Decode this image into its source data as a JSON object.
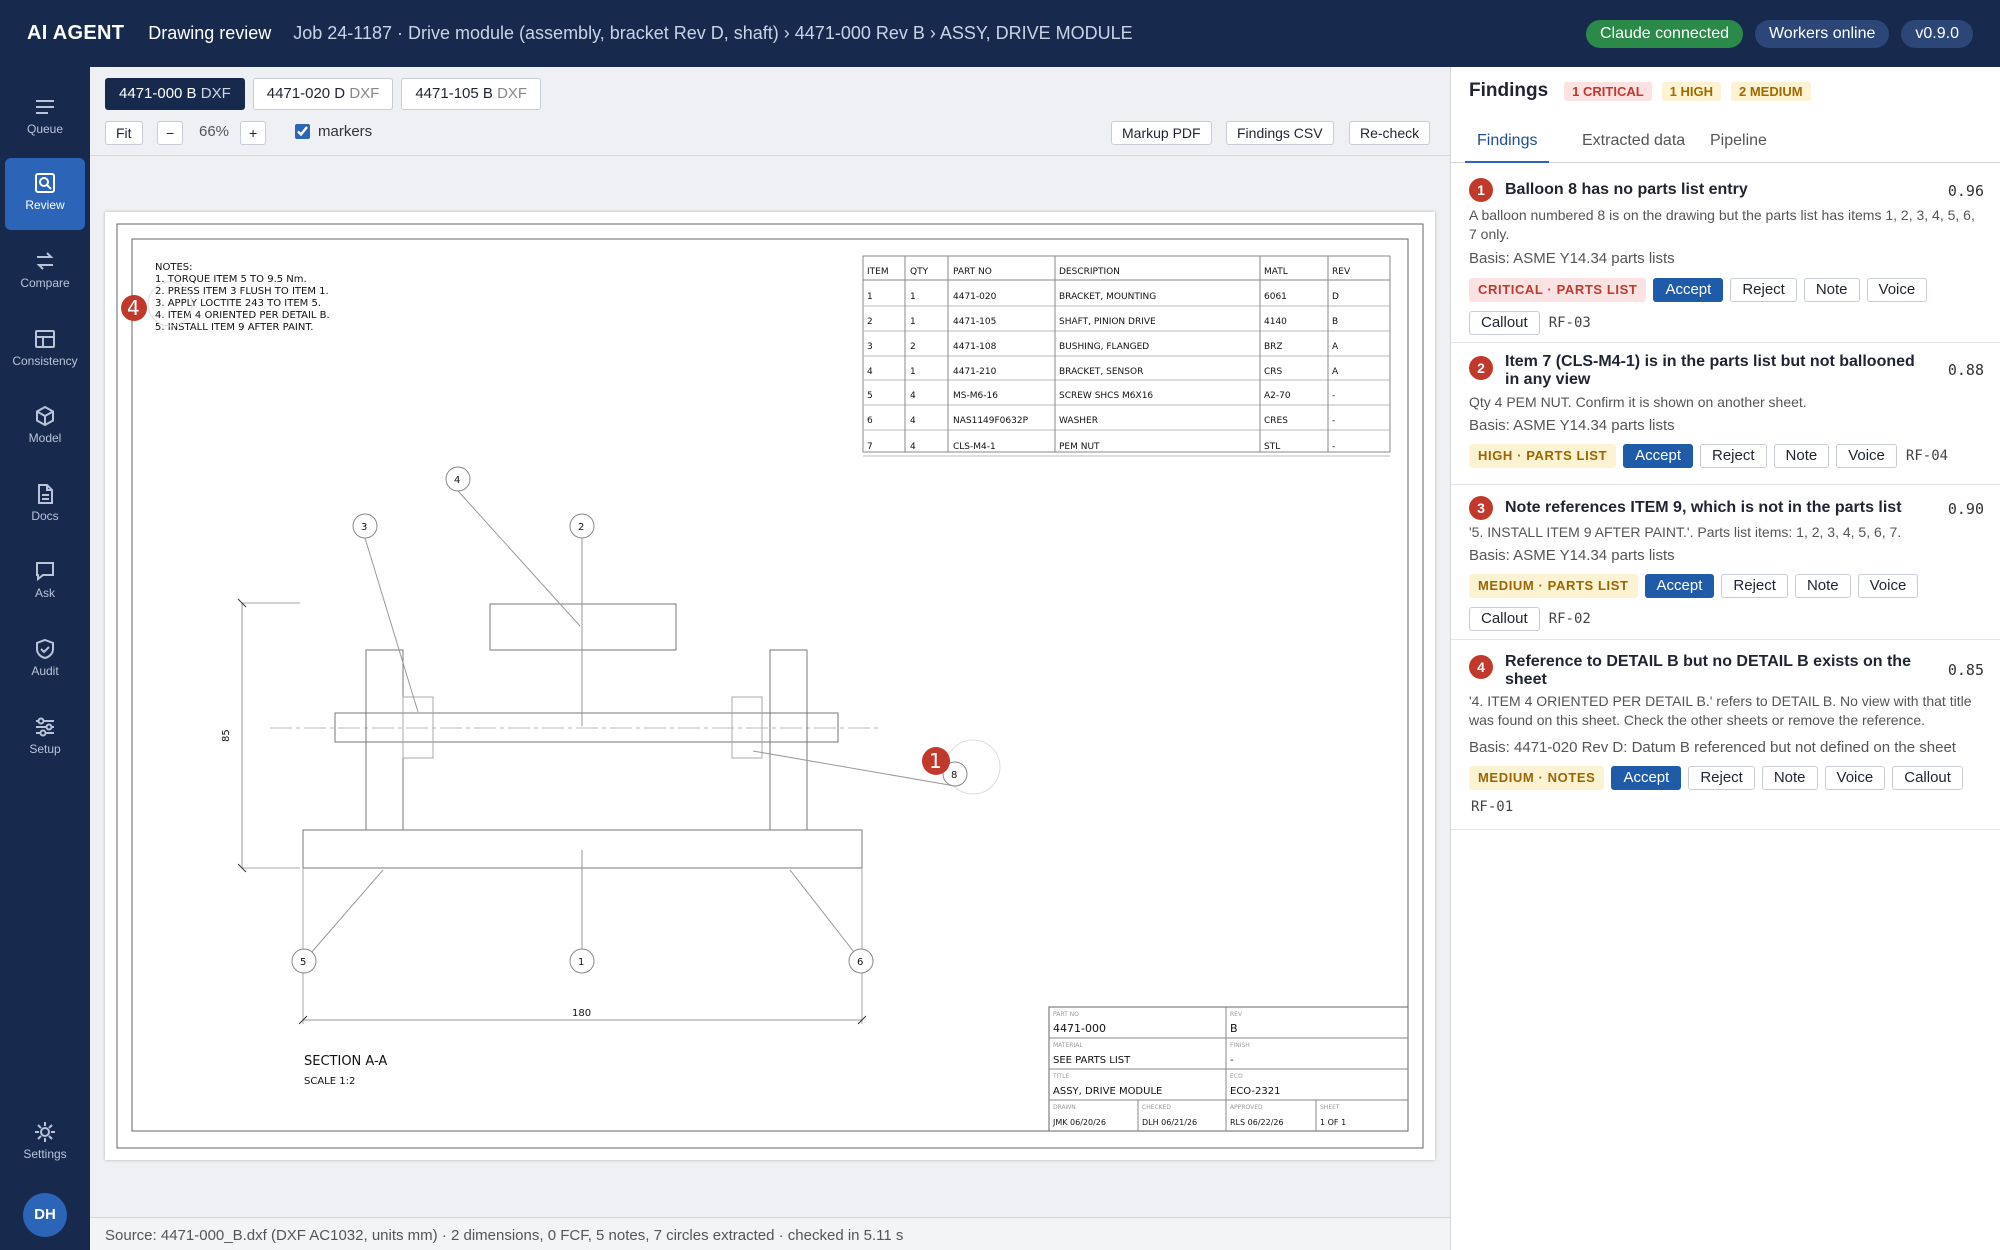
{
  "header": {
    "brand": "AI AGENT",
    "title": "Drawing review",
    "breadcrumb": "Job 24-1187 · Drive module (assembly, bracket Rev D, shaft) › 4471-000 Rev B › ASSY, DRIVE MODULE",
    "status_chips": [
      "Claude connected",
      "Workers online",
      "v0.9.0"
    ]
  },
  "sidebar": {
    "items": [
      {
        "label": "Queue",
        "icon": "queue-icon"
      },
      {
        "label": "Review",
        "icon": "review-icon",
        "active": true
      },
      {
        "label": "Compare",
        "icon": "compare-icon"
      },
      {
        "label": "Consistency",
        "icon": "consistency-icon"
      },
      {
        "label": "Model",
        "icon": "model-icon"
      },
      {
        "label": "Docs",
        "icon": "docs-icon"
      },
      {
        "label": "Ask",
        "icon": "ask-icon"
      },
      {
        "label": "Audit",
        "icon": "audit-icon"
      },
      {
        "label": "Setup",
        "icon": "setup-icon"
      }
    ],
    "settings": "Settings",
    "avatar": "DH"
  },
  "file_tabs": [
    {
      "name": "4471-000 B",
      "kind": "DXF",
      "active": true
    },
    {
      "name": "4471-020 D",
      "kind": "DXF"
    },
    {
      "name": "4471-105 B",
      "kind": "DXF"
    }
  ],
  "toolbar": {
    "fit": "Fit",
    "zoom_out": "−",
    "zoom": "66%",
    "zoom_in": "+",
    "markers_label": "markers",
    "markers_checked": true,
    "markup_pdf": "Markup PDF",
    "findings_csv": "Findings CSV",
    "recheck": "Re-check"
  },
  "drawing": {
    "notes_title": "NOTES:",
    "notes": [
      "1. TORQUE ITEM 5 TO 9.5 Nm.",
      "2. PRESS ITEM 3 FLUSH TO ITEM 1.",
      "3. APPLY LOCTITE 243 TO ITEM 5.",
      "4. ITEM 4 ORIENTED PER DETAIL B.",
      "5. INSTALL ITEM 9 AFTER PAINT."
    ],
    "bom_headers": [
      "ITEM",
      "QTY",
      "PART NO",
      "DESCRIPTION",
      "MATL",
      "REV"
    ],
    "bom_rows": [
      [
        "1",
        "1",
        "4471-020",
        "BRACKET, MOUNTING",
        "6061",
        "D"
      ],
      [
        "2",
        "1",
        "4471-105",
        "SHAFT, PINION DRIVE",
        "4140",
        "B"
      ],
      [
        "3",
        "2",
        "4471-108",
        "BUSHING, FLANGED",
        "BRZ",
        "A"
      ],
      [
        "4",
        "1",
        "4471-210",
        "BRACKET, SENSOR",
        "CRS",
        "A"
      ],
      [
        "5",
        "4",
        "MS-M6-16",
        "SCREW SHCS M6X16",
        "A2-70",
        "-"
      ],
      [
        "6",
        "4",
        "NAS1149F0632P",
        "WASHER",
        "CRES",
        "-"
      ],
      [
        "7",
        "4",
        "CLS-M4-1",
        "PEM NUT",
        "STL",
        "-"
      ]
    ],
    "balloons": [
      "1",
      "2",
      "3",
      "4",
      "5",
      "6",
      "8"
    ],
    "dim_width": "180",
    "dim_height": "85",
    "section_title": "SECTION A-A",
    "section_scale": "SCALE 1:2",
    "marker_labels": [
      "1",
      "4"
    ],
    "title_block": {
      "part_no_label": "PART NO",
      "part_no": "4471-000",
      "rev_label": "REV",
      "rev": "B",
      "material_label": "MATERIAL",
      "material": "SEE PARTS LIST",
      "finish_label": "FINISH",
      "finish": "-",
      "title_label": "TITLE",
      "title": "ASSY, DRIVE MODULE",
      "eco_label": "ECO",
      "eco": "ECO-2321",
      "drawn_label": "DRAWN",
      "drawn": "JMK 06/20/26",
      "checked_label": "CHECKED",
      "checked": "DLH 06/21/26",
      "approved_label": "APPROVED",
      "approved": "RLS 06/22/26",
      "sheet_label": "SHEET",
      "sheet": "1 OF 1"
    }
  },
  "status_bar": "Source: 4471-000_B.dxf (DXF AC1032, units mm) · 2 dimensions, 0 FCF, 5 notes, 7 circles extracted · checked in 5.11 s",
  "panel": {
    "title": "Findings",
    "counts": {
      "critical": "1 CRITICAL",
      "high": "1 HIGH",
      "medium": "2 MEDIUM"
    },
    "tabs": [
      "Findings",
      "Extracted data",
      "Pipeline"
    ],
    "actions": {
      "accept": "Accept",
      "reject": "Reject",
      "note": "Note",
      "voice": "Voice",
      "callout": "Callout"
    },
    "findings": [
      {
        "num": "1",
        "title": "Balloon 8 has no parts list entry",
        "score": "0.96",
        "description": "A balloon numbered 8 is on the drawing but the parts list has items 1, 2, 3, 4, 5, 6, 7 only.",
        "basis": "Basis: ASME Y14.34 parts lists",
        "severity": "CRITICAL · PARTS LIST",
        "rule": "RF-03"
      },
      {
        "num": "2",
        "title": "Item 7 (CLS-M4-1) is in the parts list but not ballooned in any view",
        "score": "0.88",
        "description": "Qty 4 PEM NUT. Confirm it is shown on another sheet.",
        "basis": "Basis: ASME Y14.34 parts lists",
        "severity": "HIGH · PARTS LIST",
        "rule": "RF-04"
      },
      {
        "num": "3",
        "title": "Note references ITEM 9, which is not in the parts list",
        "score": "0.90",
        "description": "'5. INSTALL ITEM 9 AFTER PAINT.'. Parts list items: 1, 2, 3, 4, 5, 6, 7.",
        "basis": "Basis: ASME Y14.34 parts lists",
        "severity": "MEDIUM · PARTS LIST",
        "rule": "RF-02"
      },
      {
        "num": "4",
        "title": "Reference to DETAIL B but no DETAIL B exists on the sheet",
        "score": "0.85",
        "description": "'4. ITEM 4 ORIENTED PER DETAIL B.' refers to DETAIL B. No view with that title was found on this sheet. Check the other sheets or remove the reference.",
        "basis": "Basis: 4471-020 Rev D: Datum B referenced but not defined on the sheet",
        "severity": "MEDIUM · NOTES",
        "rule": "RF-01"
      }
    ]
  }
}
